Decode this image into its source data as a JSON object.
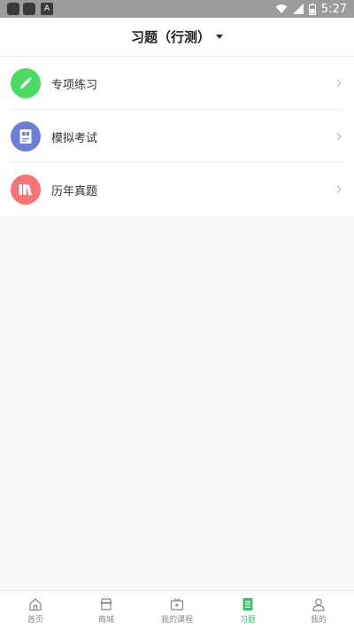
{
  "status_bar": {
    "time": "5:27",
    "badge_letter": "A"
  },
  "header": {
    "title": "习题（行测）"
  },
  "menu": [
    {
      "label": "专项练习",
      "icon": "pencil-icon",
      "color": "#4cd964"
    },
    {
      "label": "模拟考试",
      "icon": "exam-paper-icon",
      "color": "#6b7fd7"
    },
    {
      "label": "历年真题",
      "icon": "books-icon",
      "color": "#f57474"
    }
  ],
  "tabs": [
    {
      "label": "首页",
      "icon": "home-icon"
    },
    {
      "label": "商城",
      "icon": "store-icon"
    },
    {
      "label": "我的课程",
      "icon": "video-course-icon"
    },
    {
      "label": "习题",
      "icon": "document-icon",
      "active": true
    },
    {
      "label": "我的",
      "icon": "profile-icon"
    }
  ],
  "colors": {
    "accent": "#39c167",
    "status_bar": "#9b9b9b"
  }
}
